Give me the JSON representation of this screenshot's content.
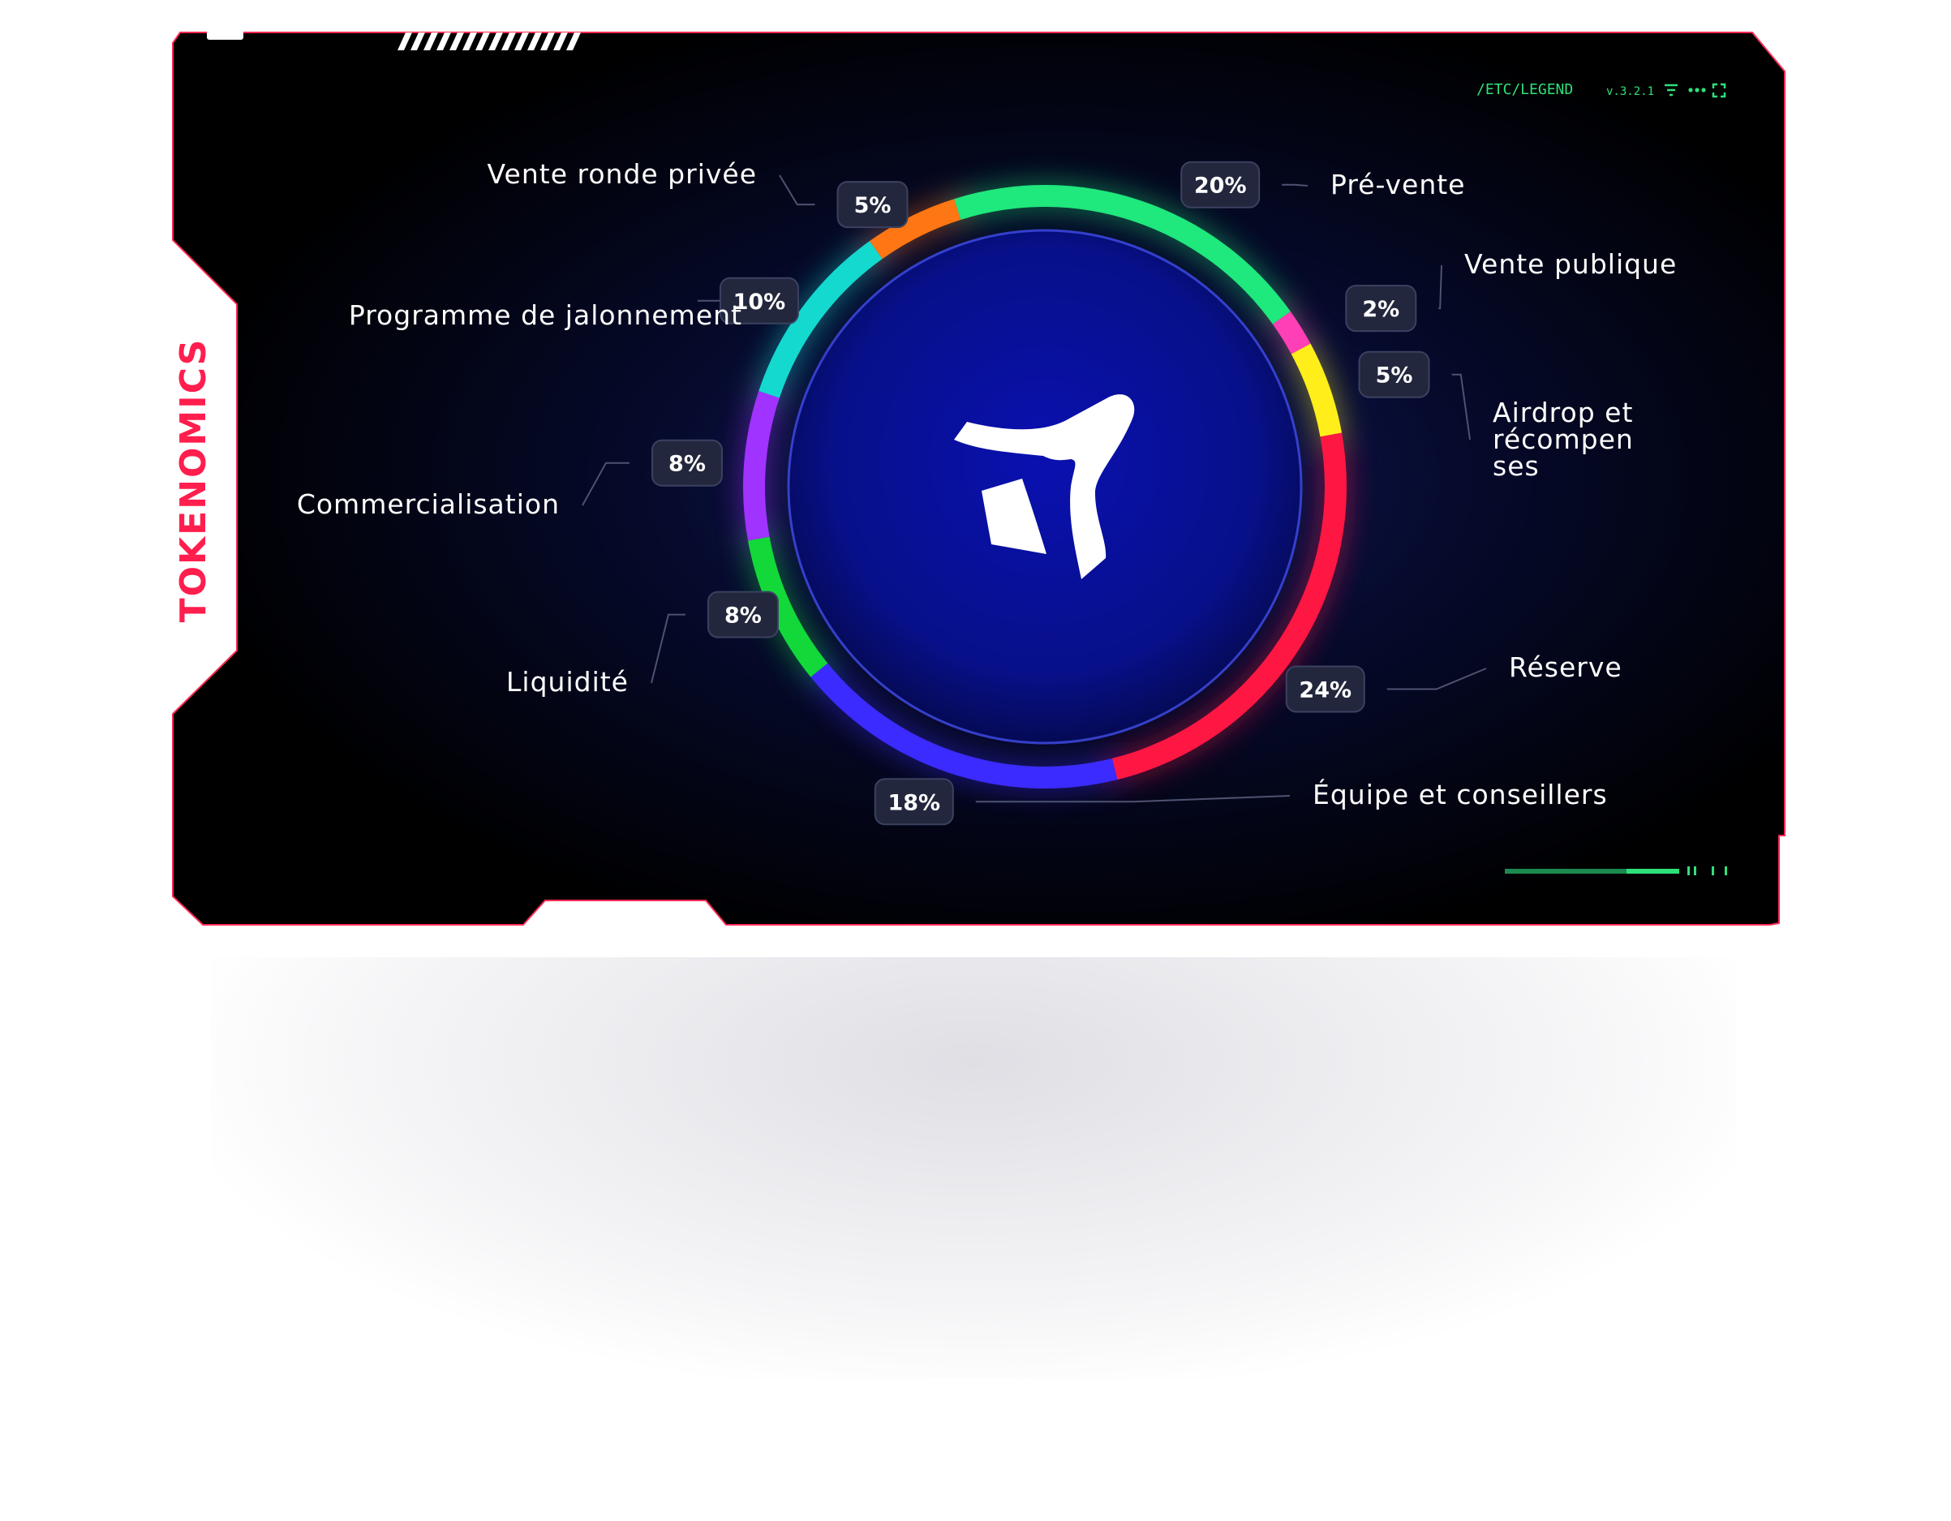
{
  "panel": {
    "title": "TOKENOMICS"
  },
  "hud": {
    "path": "/ETC/LEGEND",
    "version": "v.3.2.1"
  },
  "icons": [
    "filter-icon",
    "more-dots-icon",
    "expand-icon"
  ],
  "colors": {
    "accent_red": "#ff1e4d",
    "hud_green": "#2fe07a",
    "panel_bg": "#02030a",
    "center_blue": "#0a10a8"
  },
  "chart_data": {
    "type": "pie",
    "labels": [
      "Pré-vente",
      "Vente publique",
      "Airdrop et récompenses",
      "Réserve",
      "Équipe et conseillers",
      "Liquidité",
      "Commercialisation",
      "Programme de jalonnement",
      "Vente ronde privée"
    ],
    "label_lines": [
      [
        "Pré-vente"
      ],
      [
        "Vente publique"
      ],
      [
        "Airdrop et",
        "récompen",
        "ses"
      ],
      [
        "Réserve"
      ],
      [
        "Équipe et conseillers"
      ],
      [
        "Liquidité"
      ],
      [
        "Commercialisation"
      ],
      [
        "Programme de jalonnement"
      ],
      [
        "Vente ronde privée"
      ]
    ],
    "values": [
      20,
      2,
      5,
      24,
      18,
      8,
      8,
      10,
      5
    ],
    "value_labels": [
      "20%",
      "2%",
      "5%",
      "24%",
      "18%",
      "8%",
      "8%",
      "10%",
      "5%"
    ],
    "colors": [
      "#1fe87c",
      "#ff3fb6",
      "#ffee1a",
      "#ff1744",
      "#3b2bff",
      "#12d83a",
      "#a033ff",
      "#14d9cf",
      "#ff7614"
    ],
    "legend": "around-chart"
  }
}
